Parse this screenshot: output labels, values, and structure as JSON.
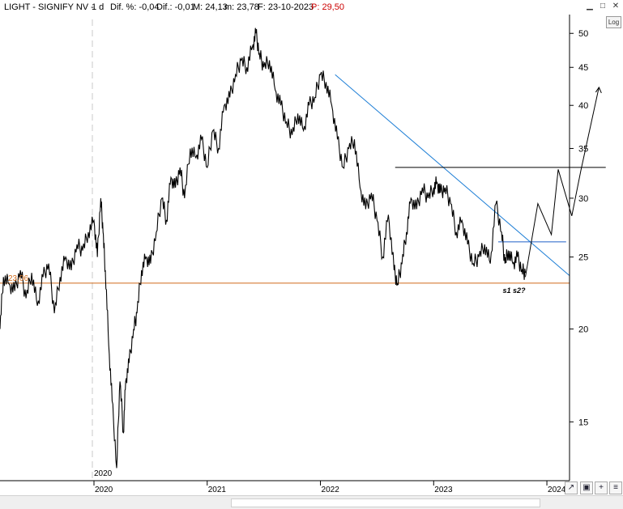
{
  "header": {
    "instrument": "LIGHT - SIGNIFY NV - ",
    "interval": "1 d",
    "change_pct": "Dif. %: -0,04",
    "change": "Dif.: -0,01",
    "max": "M: 24,13",
    "min": "m: 23,78",
    "date": "F: 23-10-2023",
    "price": "P: 29,50"
  },
  "log_button": "Log",
  "icons": {
    "minimize": "minimize-icon",
    "maximize": "maximize-icon",
    "close": "close-icon",
    "trendline_tool": "trendline-icon",
    "save": "save-icon",
    "zoom": "zoom-icon",
    "settings": "settings-icon"
  },
  "colors": {
    "price_line": "#000000",
    "trendline": "#1f7fd6",
    "support": "#d06a1a",
    "resistance": "#000000",
    "resistance_short": "#1f5fc8",
    "support_label": "#d06a1a",
    "axis": "#000000",
    "grid_divider": "#c8c8c8"
  },
  "chart_data": {
    "type": "line",
    "scale": "log",
    "ylim": [
      12.5,
      53
    ],
    "yticks": [
      15,
      20,
      25,
      30,
      35,
      40,
      45,
      50
    ],
    "ytick_labels": [
      "15",
      "20",
      "25",
      "30",
      "35",
      "40",
      "45",
      "50"
    ],
    "xticks": [
      "2020",
      "2021",
      "2022",
      "2023",
      "2024"
    ],
    "xtick_pos": [
      2020.0,
      2021.0,
      2022.0,
      2023.0,
      2024.0
    ],
    "xlim": [
      2019.17,
      2024.2
    ],
    "marker_label": "2020",
    "support_value_label": "23,06",
    "annotation": "s1 s2?",
    "series": [
      {
        "x": [
          2019.17,
          2019.2,
          2019.25,
          2019.3,
          2019.35,
          2019.4,
          2019.45,
          2019.5,
          2019.55,
          2019.6,
          2019.65,
          2019.7,
          2019.75,
          2019.8,
          2019.85,
          2019.9,
          2019.95,
          2020.0,
          2020.03,
          2020.06,
          2020.08,
          2020.1,
          2020.13,
          2020.16,
          2020.2,
          2020.23,
          2020.26,
          2020.28,
          2020.31,
          2020.35,
          2020.38,
          2020.42,
          2020.46,
          2020.5,
          2020.55,
          2020.6,
          2020.64,
          2020.68,
          2020.72,
          2020.76,
          2020.8,
          2020.85,
          2020.9,
          2020.95,
          2021.0,
          2021.05,
          2021.1,
          2021.15,
          2021.2,
          2021.25,
          2021.3,
          2021.35,
          2021.4,
          2021.43,
          2021.46,
          2021.5,
          2021.55,
          2021.6,
          2021.65,
          2021.7,
          2021.75,
          2021.8,
          2021.85,
          2021.9,
          2021.95,
          2022.0,
          2022.05,
          2022.1,
          2022.15,
          2022.2,
          2022.25,
          2022.3,
          2022.35,
          2022.4,
          2022.45,
          2022.5,
          2022.55,
          2022.6,
          2022.65,
          2022.68,
          2022.72,
          2022.76,
          2022.8,
          2022.85,
          2022.9,
          2022.95,
          2023.0,
          2023.03,
          2023.06,
          2023.1,
          2023.15,
          2023.2,
          2023.25,
          2023.3,
          2023.35,
          2023.4,
          2023.45,
          2023.5,
          2023.55,
          2023.6,
          2023.63,
          2023.66,
          2023.7,
          2023.74,
          2023.78,
          2023.81
        ],
        "values": [
          20.0,
          23.5,
          23.0,
          22.5,
          24.0,
          22.0,
          23.8,
          21.5,
          23.5,
          24.5,
          21.0,
          23.5,
          25.0,
          24.0,
          26.0,
          25.5,
          27.0,
          28.0,
          25.0,
          30.0,
          27.0,
          24.0,
          19.0,
          16.0,
          13.0,
          17.0,
          14.5,
          17.0,
          18.0,
          20.0,
          21.0,
          24.0,
          25.0,
          24.5,
          27.0,
          30.0,
          28.0,
          32.0,
          31.0,
          33.0,
          30.0,
          35.0,
          34.0,
          36.0,
          33.0,
          37.0,
          35.0,
          40.0,
          41.0,
          44.0,
          46.0,
          45.0,
          48.0,
          50.0,
          47.0,
          45.0,
          46.0,
          42.0,
          40.0,
          38.0,
          36.5,
          39.0,
          37.0,
          40.0,
          41.0,
          44.0,
          43.0,
          40.0,
          36.0,
          33.0,
          35.0,
          36.0,
          31.0,
          29.0,
          30.5,
          28.0,
          25.0,
          28.5,
          24.0,
          23.0,
          24.5,
          27.0,
          30.0,
          29.0,
          31.0,
          30.0,
          31.0,
          31.5,
          30.5,
          31.0,
          29.5,
          27.0,
          28.0,
          26.0,
          24.5,
          25.0,
          26.0,
          24.5,
          29.5,
          27.0,
          24.5,
          25.5,
          24.5,
          25.0,
          24.0,
          23.8
        ]
      }
    ],
    "projection": {
      "x": [
        2023.81,
        2023.92,
        2024.04,
        2024.1,
        2024.22,
        2024.3,
        2024.46
      ],
      "values": [
        23.5,
        29.5,
        26.8,
        32.8,
        28.4,
        32.7,
        42.3
      ]
    },
    "trendline": {
      "x": [
        2022.13,
        2024.2
      ],
      "values": [
        44.0,
        23.6
      ]
    },
    "resistance": {
      "x": [
        2022.66,
        2024.52
      ],
      "values": [
        33.0,
        33.0
      ]
    },
    "resistance_short": {
      "x": [
        2023.57,
        2024.17
      ],
      "values": [
        26.2,
        26.2
      ]
    },
    "support": {
      "x": [
        2019.17,
        2024.2
      ],
      "values": [
        23.06,
        23.06
      ]
    }
  }
}
